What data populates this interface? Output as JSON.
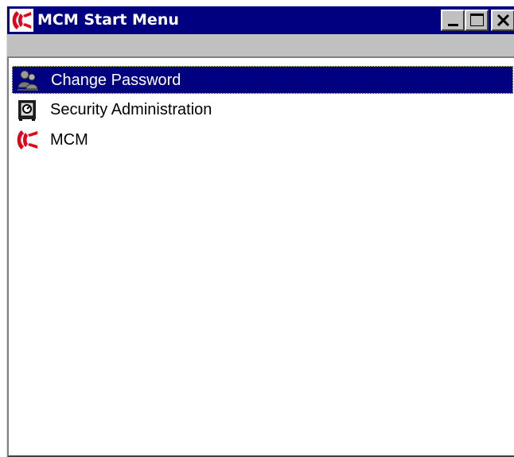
{
  "window": {
    "title": "MCM Start Menu",
    "app_icon": "mcm-logo-icon",
    "controls": {
      "minimize_icon": "minimize-icon",
      "maximize_icon": "maximize-icon",
      "close_icon": "close-icon"
    }
  },
  "list": {
    "items": [
      {
        "label": "Change Password",
        "icon": "users-keys-icon",
        "selected": true
      },
      {
        "label": "Security Administration",
        "icon": "safe-icon",
        "selected": false
      },
      {
        "label": "MCM",
        "icon": "mcm-logo-icon",
        "selected": false
      }
    ]
  },
  "colors": {
    "titlebar": "#000080",
    "selection": "#000080",
    "brand_red": "#e3001b",
    "face": "#c0c0c0"
  }
}
